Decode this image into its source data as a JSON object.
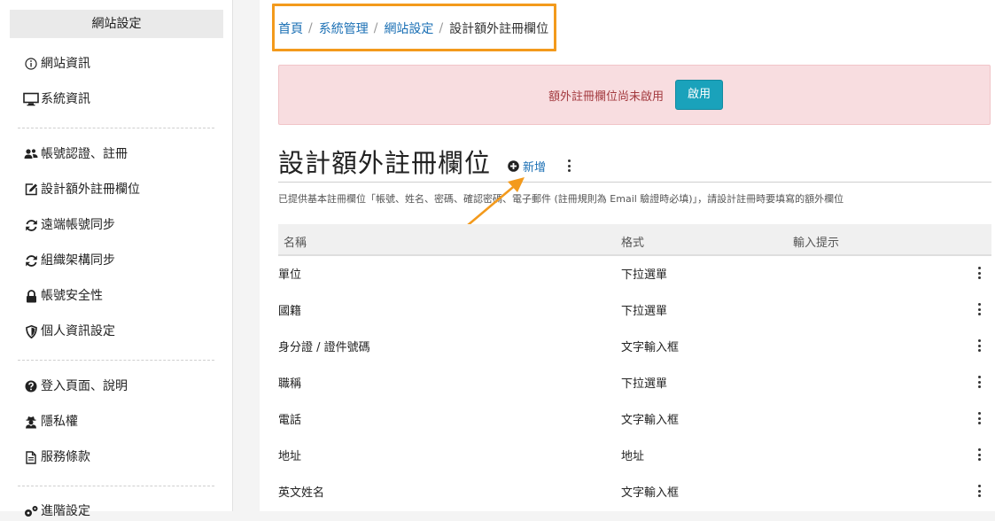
{
  "sidebar": {
    "header": "網站設定",
    "items": [
      {
        "label": "網站資訊",
        "icon": "info-circle-icon"
      },
      {
        "label": "系統資訊",
        "icon": "monitor-icon"
      },
      {
        "label": "帳號認證、註冊",
        "icon": "users-icon"
      },
      {
        "label": "設計額外註冊欄位",
        "icon": "edit-icon"
      },
      {
        "label": "遠端帳號同步",
        "icon": "sync-icon"
      },
      {
        "label": "組織架構同步",
        "icon": "sync-icon"
      },
      {
        "label": "帳號安全性",
        "icon": "lock-icon"
      },
      {
        "label": "個人資訊設定",
        "icon": "shield-icon"
      },
      {
        "label": "登入頁面、說明",
        "icon": "question-circle-icon"
      },
      {
        "label": "隱私權",
        "icon": "user-secret-icon"
      },
      {
        "label": "服務條款",
        "icon": "document-icon"
      },
      {
        "label": "進階設定",
        "icon": "gears-icon"
      }
    ]
  },
  "breadcrumb": {
    "items": [
      "首頁",
      "系統管理",
      "網站設定"
    ],
    "current": "設計額外註冊欄位"
  },
  "alert": {
    "text": "額外註冊欄位尚未啟用",
    "button": "啟用",
    "colors": {
      "background": "#f8dde0",
      "text": "#a33a3f",
      "button": "#1aa2bb"
    }
  },
  "page": {
    "title": "設計額外註冊欄位",
    "add_label": "新增",
    "description": "已提供基本註冊欄位「帳號、姓名、密碼、確認密碼、電子郵件 (註冊規則為 Email 驗證時必填)」，請設計註冊時要填寫的額外欄位"
  },
  "table": {
    "columns": [
      "名稱",
      "格式",
      "輸入提示"
    ],
    "rows": [
      {
        "name": "單位",
        "format": "下拉選單",
        "hint": ""
      },
      {
        "name": "國籍",
        "format": "下拉選單",
        "hint": ""
      },
      {
        "name": "身分證 / 證件號碼",
        "format": "文字輸入框",
        "hint": ""
      },
      {
        "name": "職稱",
        "format": "下拉選單",
        "hint": ""
      },
      {
        "name": "電話",
        "format": "文字輸入框",
        "hint": ""
      },
      {
        "name": "地址",
        "format": "地址",
        "hint": ""
      },
      {
        "name": "英文姓名",
        "format": "文字輸入框",
        "hint": ""
      }
    ]
  },
  "annotation_colors": {
    "highlight": "#f39a1c",
    "link": "#1a6fb4"
  }
}
